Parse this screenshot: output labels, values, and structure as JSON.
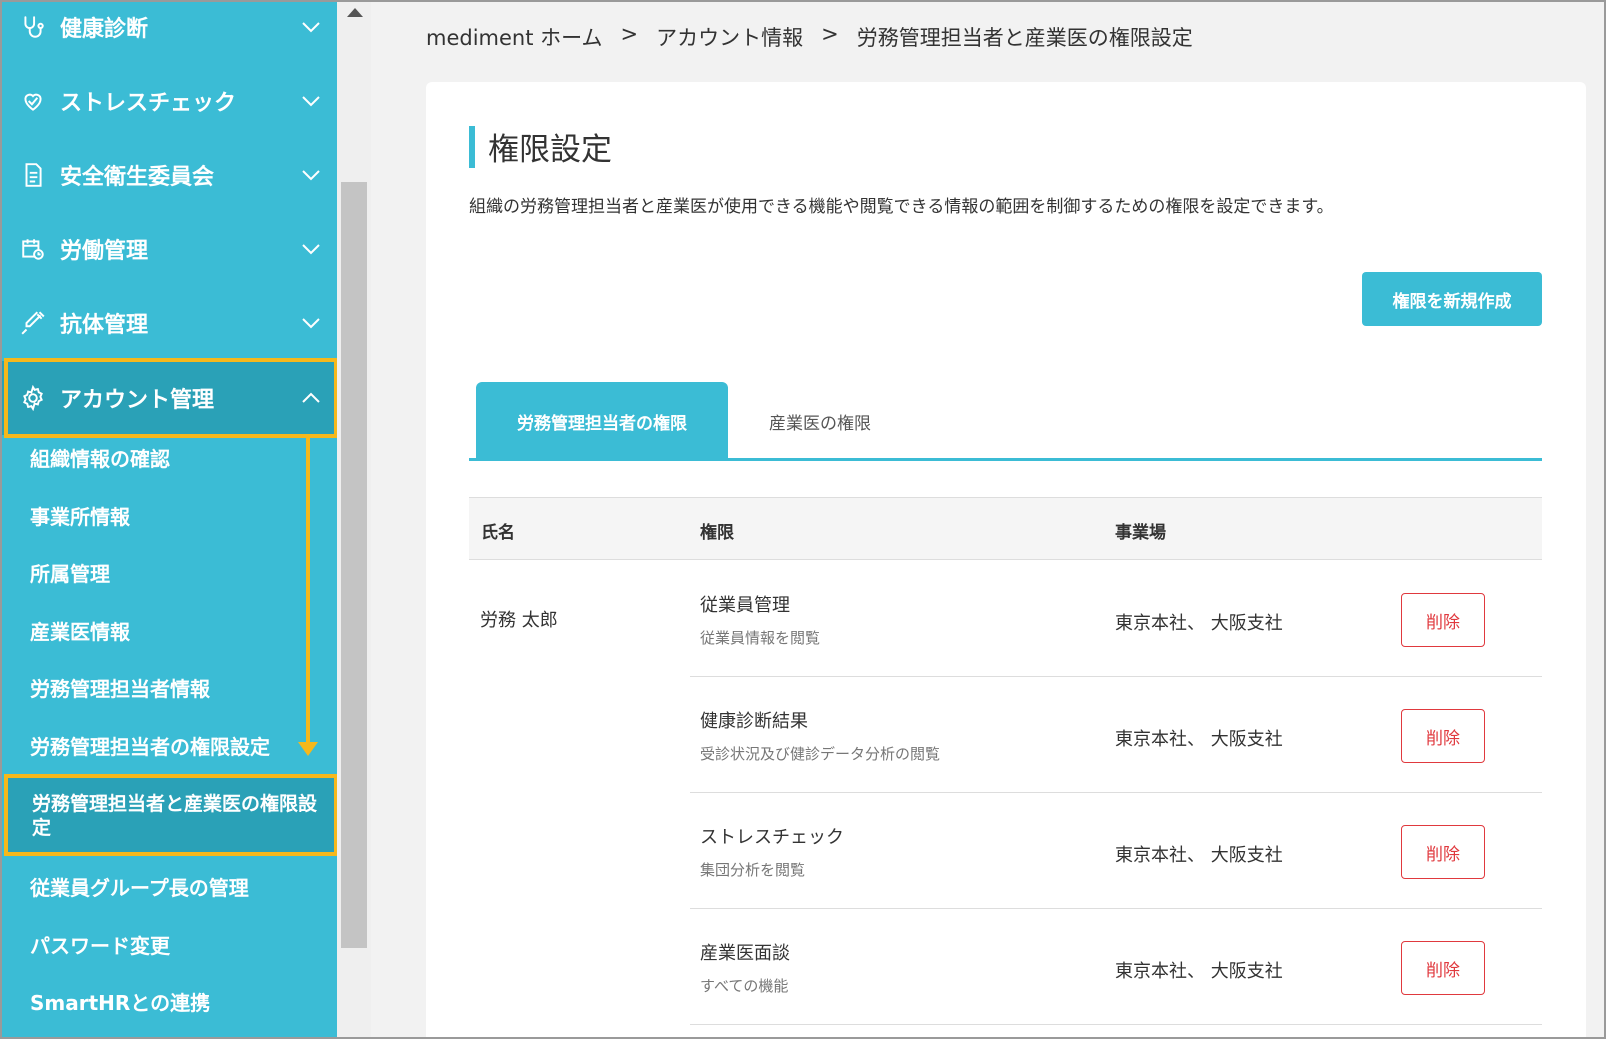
{
  "colors": {
    "primary": "#3bbcd5",
    "primary_dark": "#2aa1b7",
    "highlight": "#f5b81c",
    "danger": "#e0393e"
  },
  "sidebar": {
    "items": [
      {
        "label": "健康診断",
        "icon": "stethoscope-icon"
      },
      {
        "label": "ストレスチェック",
        "icon": "heart-icon"
      },
      {
        "label": "安全衛生委員会",
        "icon": "document-icon"
      },
      {
        "label": "労働管理",
        "icon": "calendar-clock-icon"
      },
      {
        "label": "抗体管理",
        "icon": "syringe-icon"
      },
      {
        "label": "アカウント管理",
        "icon": "gear-icon"
      }
    ],
    "sub_items": [
      "組織情報の確認",
      "事業所情報",
      "所属管理",
      "産業医情報",
      "労務管理担当者情報",
      "労務管理担当者の権限設定",
      "労務管理担当者と産業医の権限設定",
      "従業員グループ長の管理",
      "パスワード変更",
      "SmartHRとの連携"
    ]
  },
  "breadcrumb": [
    "mediment ホーム",
    "アカウント情報",
    "労務管理担当者と産業医の権限設定"
  ],
  "breadcrumb_sep": ">",
  "page": {
    "title": "権限設定",
    "description": "組織の労務管理担当者と産業医が使用できる機能や閲覧できる情報の範囲を制御するための権限を設定できます。",
    "new_button": "権限を新規作成"
  },
  "tabs": [
    {
      "label": "労務管理担当者の権限",
      "active": true
    },
    {
      "label": "産業医の権限",
      "active": false
    }
  ],
  "table": {
    "headers": [
      "氏名",
      "権限",
      "事業場"
    ],
    "name": "労務 太郎",
    "rows": [
      {
        "perm": "従業員管理",
        "desc": "従業員情報を閲覧",
        "site": "東京本社、 大阪支社",
        "action": "削除"
      },
      {
        "perm": "健康診断結果",
        "desc": "受診状況及び健診データ分析の閲覧",
        "site": "東京本社、 大阪支社",
        "action": "削除"
      },
      {
        "perm": "ストレスチェック",
        "desc": "集団分析を閲覧",
        "site": "東京本社、 大阪支社",
        "action": "削除"
      },
      {
        "perm": "産業医面談",
        "desc": "すべての機能",
        "site": "東京本社、 大阪支社",
        "action": "削除"
      }
    ]
  }
}
